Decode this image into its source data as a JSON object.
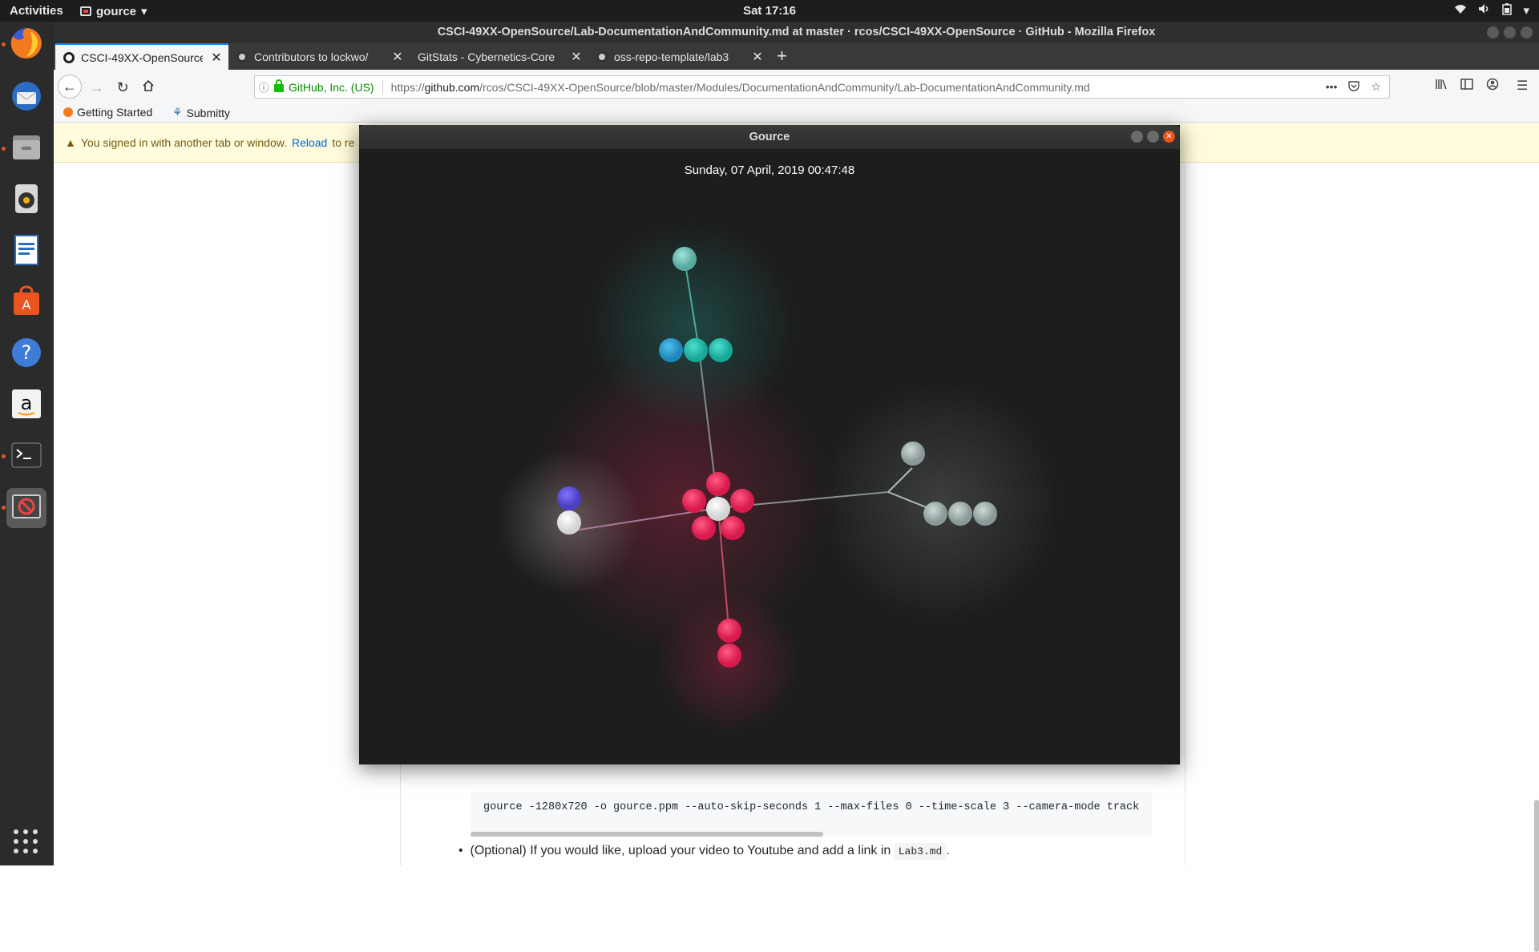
{
  "topbar": {
    "activities": "Activities",
    "app_name": "gource",
    "clock": "Sat 17:16"
  },
  "dock": {
    "items": [
      "firefox-icon",
      "thunderbird-icon",
      "files-icon",
      "rhythmbox-icon",
      "writer-icon",
      "software-center-icon",
      "help-icon",
      "amazon-icon",
      "terminal-icon",
      "gource-icon"
    ]
  },
  "firefox": {
    "window_title": "CSCI-49XX-OpenSource/Lab-DocumentationAndCommunity.md at master · rcos/CSCI-49XX-OpenSource · GitHub - Mozilla Firefox",
    "tabs": [
      {
        "label": "CSCI-49XX-OpenSource/"
      },
      {
        "label": "Contributors to lockwo/"
      },
      {
        "label": "GitStats - Cybernetics-Core"
      },
      {
        "label": "oss-repo-template/lab3"
      }
    ],
    "url": {
      "org": "GitHub, Inc. (US)",
      "prefix": "https://",
      "host": "github.com",
      "path": "/rcos/CSCI-49XX-OpenSource/blob/master/Modules/DocumentationAndCommunity/Lab-DocumentationAndCommunity.md"
    },
    "bookmarks": [
      {
        "label": "Getting Started"
      },
      {
        "label": "Submitty"
      }
    ],
    "notice": {
      "text": "You signed in with another tab or window.",
      "link": "Reload",
      "tail": "to re"
    },
    "code_line": "gource -1280x720 -o gource.ppm --auto-skip-seconds 1 --max-files 0 --time-scale 3 --camera-mode track",
    "bullet": {
      "text": "(Optional) If you would like, upload your video to Youtube and add a link in",
      "code": "Lab3.md",
      "end": "."
    }
  },
  "gource": {
    "title": "Gource",
    "date": "Sunday, 07 April, 2019 00:47:48",
    "colors": {
      "pink": "#e8245a",
      "teal": "#1fc2b0",
      "blue": "#2aa3d6",
      "gray": "#aab7b5",
      "purple": "#5a4fd8",
      "white": "#f2f2f2",
      "background": "#1d1d1d"
    }
  }
}
